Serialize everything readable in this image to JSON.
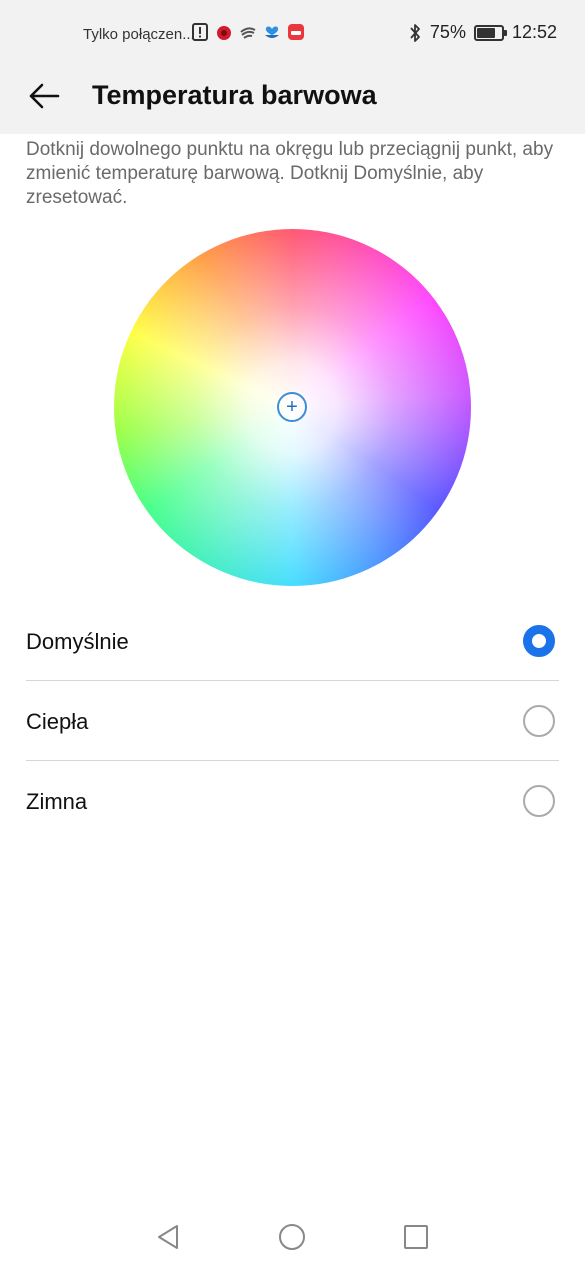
{
  "status_bar": {
    "carrier_text": "Tylko połączen...",
    "notification_icons": [
      "alert-icon",
      "app-bug-icon",
      "wifi-calling-icon",
      "heart-hands-icon",
      "app-store-icon"
    ],
    "bluetooth_icon": "bluetooth-icon",
    "battery_percent": "75%",
    "battery_level": 0.75,
    "time": "12:52"
  },
  "header": {
    "back_icon": "arrow-left-icon",
    "title": "Temperatura barwowa"
  },
  "description": "Dotknij dowolnego punktu na okręgu lub przeciągnij punkt, aby zmienić temperaturę barwową. Dotknij Domyślnie, aby zresetować.",
  "color_wheel": {
    "marker_icon": "plus-icon",
    "marker_glyph": "+"
  },
  "options": [
    {
      "label": "Domyślnie",
      "selected": true
    },
    {
      "label": "Ciepła",
      "selected": false
    },
    {
      "label": "Zimna",
      "selected": false
    }
  ],
  "accent_color": "#1a73e8",
  "nav_bar": {
    "back_icon": "triangle-back-icon",
    "home_icon": "circle-home-icon",
    "recents_icon": "square-recents-icon"
  }
}
